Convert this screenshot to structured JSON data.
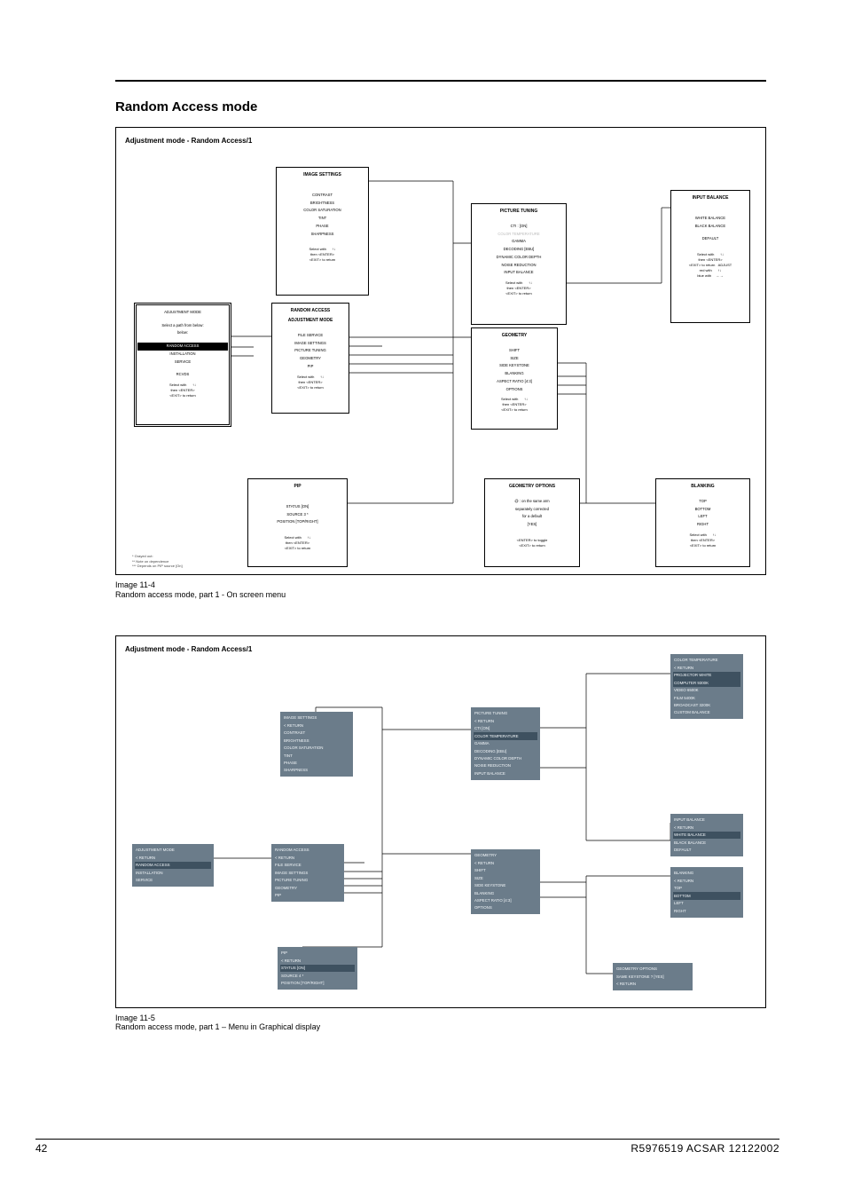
{
  "section_title": "Random Access mode",
  "panel_title": "Adjustment mode - Random Access/1",
  "caption1_label": "Image 11-4",
  "caption1_text": "Random access mode, part 1 - On screen menu",
  "caption2_label": "Image 11-5",
  "caption2_text": "Random access mode, part 1 – Menu in Graphical display",
  "footer_page": "42",
  "footer_doc": "R5976519 ACSAR 12122002",
  "common_footer": {
    "select": "Select with",
    "arrows": "↑↓",
    "enter": "then <ENTER>",
    "exit": "<EXIT> to return"
  },
  "d1": {
    "adjustment_mode": {
      "hdr": "ADJUSTMENT MODE",
      "hint": "Select a path from below:",
      "items": [
        "RANDOM ACCESS",
        "INSTALLATION",
        "SERVICE"
      ],
      "rcvds": "RCVDS"
    },
    "random_access": {
      "hdr1": "RANDOM ACCESS",
      "hdr2": "ADJUSTMENT MODE",
      "items": [
        "FILE SERVICE",
        "IMAGE SETTINGS",
        "PICTURE TUNING",
        "GEOMETRY",
        "PIP"
      ]
    },
    "image_settings": {
      "hdr": "IMAGE SETTINGS",
      "items": [
        "CONTRAST",
        "BRIGHTNESS",
        "COLOR SATURATION",
        "TINT",
        "PHASE",
        "SHARPNESS"
      ]
    },
    "picture_tuning": {
      "hdr": "PICTURE TUNING",
      "items": [
        "CTI : [ON]",
        "COLOR TEMPERATURE",
        "GAMMA",
        "DECODING [EBU]",
        "DYNAMIC COLOR DEPTH",
        "NOISE REDUCTION",
        "INPUT BALANCE"
      ]
    },
    "geometry": {
      "hdr": "GEOMETRY",
      "items": [
        "SHIFT",
        "SIZE",
        "SIDE KEYSTONE",
        "BLANKING",
        "ASPECT RATIO [4:3]",
        "OPTIONS"
      ]
    },
    "input_balance": {
      "hdr": "INPUT BALANCE",
      "items": [
        "WHITE BALANCE",
        "BLACK BALANCE"
      ],
      "default": "DEFAULT",
      "with": "↑↓",
      "adjust": "ADJUST",
      "red": "red with",
      "blue": "blue with",
      "arrows2": "←→"
    },
    "pip": {
      "hdr": "PIP",
      "items": [
        "STATUS [ON]",
        "SOURCE 3 *",
        "POSITION [TOP/RIGHT]"
      ]
    },
    "geometry_options": {
      "hdr": "GEOMETRY OPTIONS",
      "items": [
        "@ : on the same arm",
        "separately corrected",
        "for a default",
        "[YES]"
      ],
      "enter": "<ENTER> to toggle",
      "exit": "<EXIT> to return"
    },
    "blanking": {
      "hdr": "BLANKING",
      "items": [
        "TOP",
        "BOTTOM",
        "LEFT",
        "RIGHT"
      ]
    },
    "footnotes": [
      "* Grayed out:",
      "** Note on dependence",
      "*** Depends on PIP source [On]"
    ]
  },
  "d2": {
    "adjustment_mode": {
      "hdr": "ADJUSTMENT MODE",
      "items": [
        "< RETURN",
        "RANDOM ACCESS",
        "INSTALLATION",
        "SERVICE"
      ]
    },
    "random_access": {
      "hdr": "RANDOM ACCESS",
      "items": [
        "< RETURN",
        "FILE SERVICE",
        "IMAGE SETTINGS",
        "PICTURE TUNING",
        "GEOMETRY",
        "PIP"
      ]
    },
    "image_settings": {
      "hdr": "IMAGE SETTINGS",
      "items": [
        "< RETURN",
        "CONTRAST",
        "BRIGHTNESS",
        "COLOR SATURATION",
        "TINT",
        "PHASE",
        "SHARPNESS"
      ]
    },
    "picture_tuning": {
      "hdr": "PICTURE TUNING",
      "items": [
        "< RETURN",
        "CTI [ON]",
        "COLOR TEMPERATURE",
        "GAMMA",
        "DECODING [EBU]",
        "DYNAMIC COLOR DEPTH",
        "NOISE REDUCTION",
        "INPUT BALANCE"
      ]
    },
    "color_temperature": {
      "hdr": "COLOR TEMPERATURE",
      "items": [
        "< RETURN",
        "PROJECTOR WHITE",
        "COMPUTER 9300K",
        "VIDEO 6500K",
        "FILM 5400K",
        "BROADCAST 3200K",
        "CUSTOM BALANCE"
      ]
    },
    "geometry": {
      "hdr": "GEOMETRY",
      "items": [
        "< RETURN",
        "SHIFT",
        "SIZE",
        "SIDE KEYSTONE",
        "BLANKING",
        "ASPECT RATIO [4:3]",
        "OPTIONS"
      ]
    },
    "input_balance": {
      "hdr": "INPUT BALANCE",
      "items": [
        "< RETURN",
        "WHITE BALANCE",
        "BLACK BALANCE",
        "DEFAULT"
      ]
    },
    "blanking": {
      "hdr": "BLANKING",
      "items": [
        "< RETURN",
        "TOP",
        "BOTTOM",
        "LEFT",
        "RIGHT"
      ]
    },
    "pip": {
      "hdr": "PIP",
      "items": [
        "< RETURN",
        "STATUS [ON]",
        "SOURCE 4 *",
        "POSITION [TOP/RIGHT]"
      ]
    },
    "geometry_options": {
      "hdr": "GEOMETRY OPTIONS",
      "items": [
        "SAME KEYSTONE ? [YES]",
        "< RETURN"
      ]
    }
  }
}
